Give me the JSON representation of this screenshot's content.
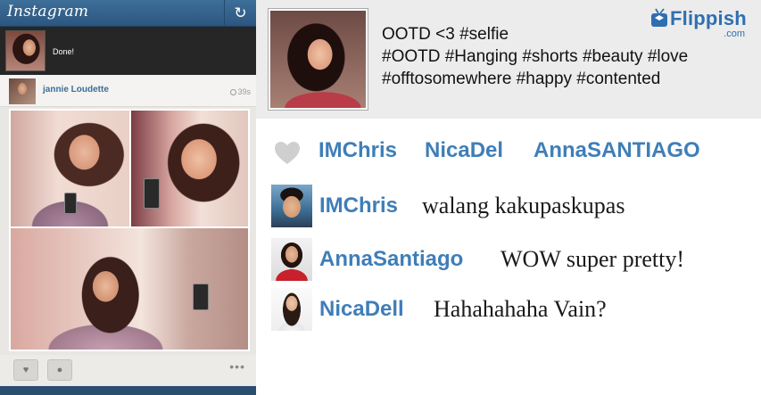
{
  "instagram": {
    "logo": "Instagram",
    "refresh_icon": "refresh-icon",
    "upload_status": "Done!",
    "post": {
      "username": "jannie Loudette",
      "time": "39s"
    },
    "more_label": "•••"
  },
  "overlay": {
    "caption_lines": [
      "OOTD <3 #selfie",
      "#OOTD #Hanging #shorts #beauty #love",
      "#offtosomewhere #happy #contented"
    ],
    "brand": {
      "name": "Flippish",
      "domain": ".com"
    },
    "likers": [
      "IMChris",
      "NicaDel",
      "AnnaSANTIAGO"
    ],
    "comments": [
      {
        "user": "IMChris",
        "text": "walang kakupaskupas"
      },
      {
        "user": "AnnaSantiago",
        "text": "WOW super pretty!"
      },
      {
        "user": "NicaDell",
        "text": "Hahahahaha Vain?"
      }
    ]
  },
  "colors": {
    "instagram_header": "#2c5680",
    "link_blue": "#3f7eb8",
    "caption_bg": "#ececec",
    "brand_blue": "#2f6fb0"
  }
}
